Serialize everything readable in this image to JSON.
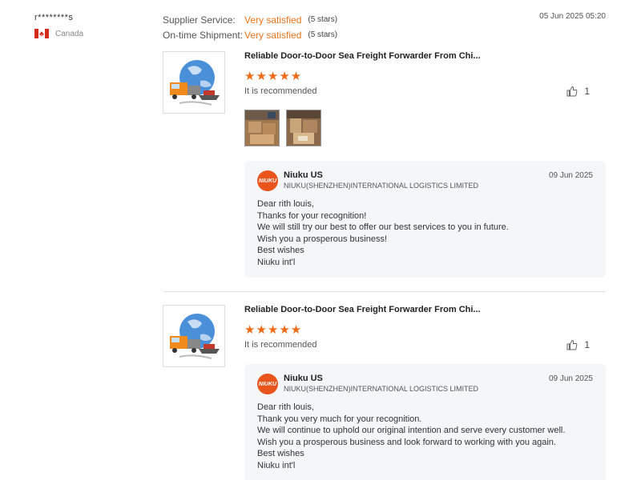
{
  "reviewer": {
    "name": "r********s",
    "country": "Canada"
  },
  "ratings": [
    {
      "label": "Supplier Service:",
      "value": "Very satisfied",
      "stars": "(5 stars)"
    },
    {
      "label": "On-time Shipment:",
      "value": "Very satisfied",
      "stars": "(5 stars)"
    }
  ],
  "review_date": "05 Jun 2025 05:20",
  "colors": {
    "accent": "#e8741b",
    "stars": "#f06a18",
    "reply_bg": "#f5f6f8"
  },
  "reviews": [
    {
      "product_title": "Reliable Door-to-Door Sea Freight Forwarder From Chi...",
      "stars": "★★★★★",
      "rating": 5,
      "recommend": "It is recommended",
      "likes": "1",
      "reply": {
        "name": "Niuku US",
        "company": "NIUKU(SHENZHEN)INTERNATIONAL LOGISTICS LIMITED",
        "date": "09 Jun 2025",
        "lines": [
          "Dear rith louis,",
          "Thanks for your recognition!",
          "We will still try our best to offer our best services to you in future.",
          "Wish you a prosperous business!",
          "Best wishes",
          "Niuku int'l"
        ]
      }
    },
    {
      "product_title": "Reliable Door-to-Door Sea Freight Forwarder From Chi...",
      "stars": "★★★★★",
      "rating": 5,
      "recommend": "It is recommended",
      "likes": "1",
      "reply": {
        "name": "Niuku US",
        "company": "NIUKU(SHENZHEN)INTERNATIONAL LOGISTICS LIMITED",
        "date": "09 Jun 2025",
        "lines": [
          "Dear rith louis,",
          "Thank you very much for your recognition.",
          "We will continue to uphold our original intention and serve every customer well.",
          "Wish you a prosperous business and look forward to working with you again.",
          "Best wishes",
          "Niuku int'l"
        ]
      }
    }
  ]
}
